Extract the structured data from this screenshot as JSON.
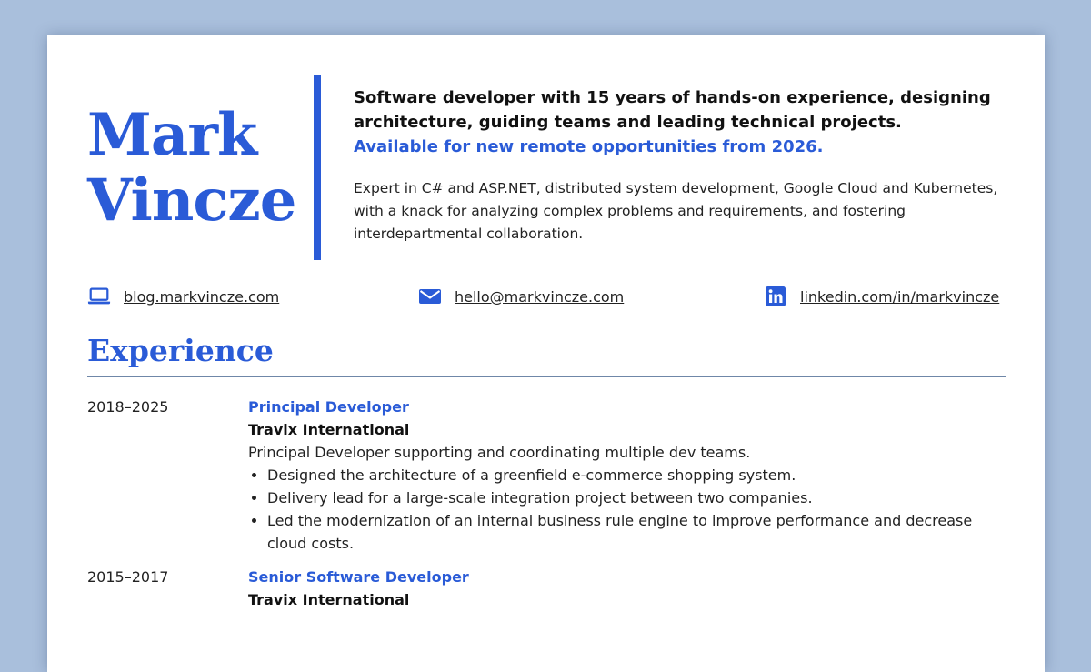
{
  "header": {
    "first_name": "Mark",
    "last_name": "Vincze",
    "headline": "Software developer with 15 years of hands-on experience, designing architecture, guiding teams and leading technical projects.",
    "availability": "Available for new remote opportunities from 2026.",
    "summary": "Expert in C# and ASP.NET, distributed system development, Google Cloud and Kubernetes, with a knack for analyzing complex problems and requirements, and fostering interdepartmental collaboration."
  },
  "contacts": {
    "blog": {
      "label": "blog.markvincze.com",
      "icon": "laptop-icon"
    },
    "email": {
      "label": "hello@markvincze.com",
      "icon": "envelope-icon"
    },
    "linkedin": {
      "label": "linkedin.com/in/markvincze",
      "icon": "linkedin-icon"
    }
  },
  "experience": {
    "title": "Experience",
    "jobs": [
      {
        "dates": "2018–2025",
        "role": "Principal Developer",
        "company": "Travix International",
        "description": "Principal Developer supporting and coordinating multiple dev teams.",
        "bullets": [
          "Designed the architecture of a greenfield e-commerce shopping system.",
          "Delivery lead for a large-scale integration project between two companies.",
          "Led the modernization of an internal business rule engine to improve performance and decrease cloud costs."
        ]
      },
      {
        "dates": "2015–2017",
        "role": "Senior Software Developer",
        "company": "Travix International"
      }
    ]
  },
  "colors": {
    "accent": "#2a5bd7",
    "background": "#a9bfdc",
    "text": "#222222",
    "rule": "#6f87a8"
  }
}
